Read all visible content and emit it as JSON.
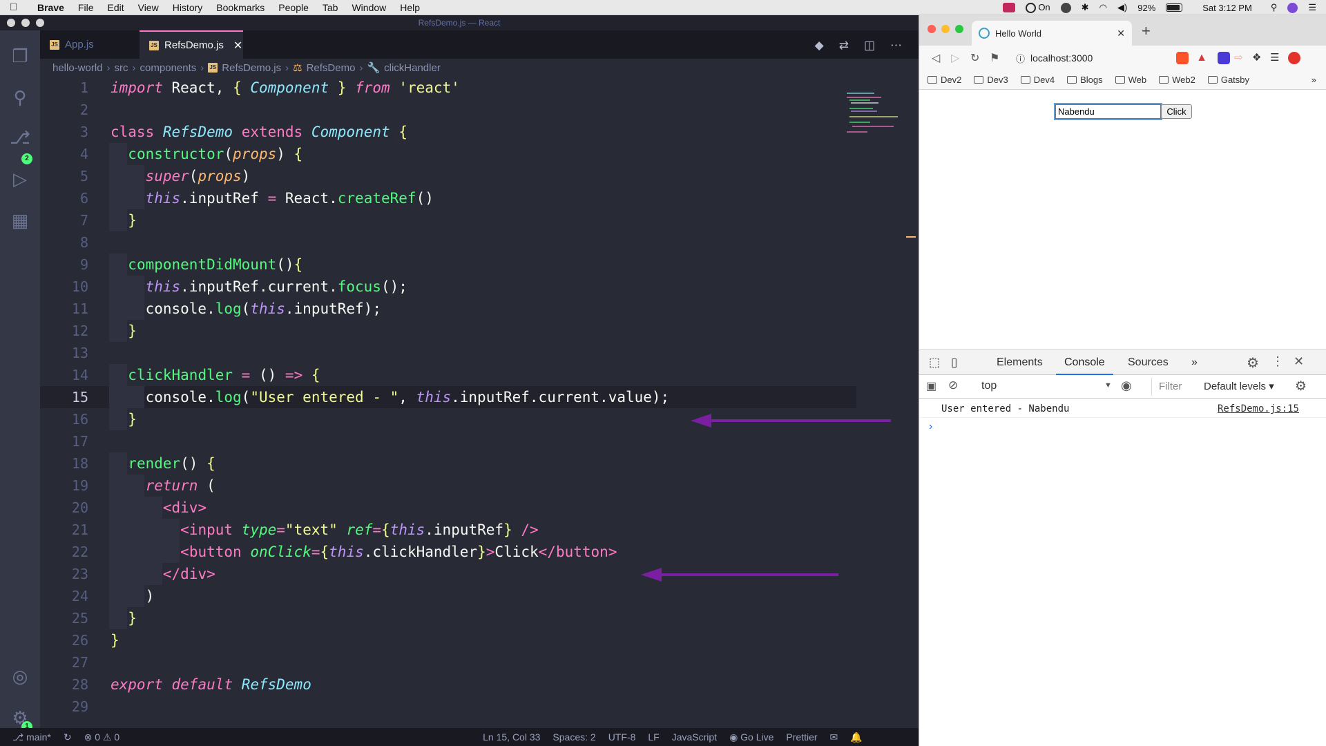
{
  "menubar": {
    "app": "Brave",
    "items": [
      "File",
      "Edit",
      "View",
      "History",
      "Bookmarks",
      "People",
      "Tab",
      "Window",
      "Help"
    ],
    "status_on": "On",
    "battery": "92%",
    "clock": "Sat 3:12 PM"
  },
  "vscode": {
    "title": "RefsDemo.js — React",
    "tabs": [
      {
        "label": "App.js"
      },
      {
        "label": "RefsDemo.js"
      }
    ],
    "breadcrumb": [
      "hello-world",
      "src",
      "components",
      "RefsDemo.js",
      "RefsDemo",
      "clickHandler"
    ],
    "badges": {
      "source_control": "2",
      "manage": "1"
    },
    "code_lines": [
      "import React, { Component } from 'react'",
      "",
      "class RefsDemo extends Component {",
      "  constructor(props) {",
      "    super(props)",
      "    this.inputRef = React.createRef()",
      "  }",
      "",
      "  componentDidMount(){",
      "    this.inputRef.current.focus();",
      "    console.log(this.inputRef);",
      "  }",
      "",
      "  clickHandler = () => {",
      "    console.log(\"User entered - \", this.inputRef.current.value);",
      "  }",
      "",
      "  render() {",
      "    return (",
      "      <div>",
      "        <input type=\"text\" ref={this.inputRef} />",
      "        <button onClick={this.clickHandler}>Click</button>",
      "      </div>",
      "    )",
      "  }",
      "}",
      "",
      "export default RefsDemo",
      ""
    ],
    "current_line": 15,
    "status": {
      "branch": "main*",
      "errors": "0",
      "warnings": "0",
      "position": "Ln 15, Col 33",
      "spaces": "Spaces: 2",
      "encoding": "UTF-8",
      "eol": "LF",
      "language": "JavaScript",
      "go_live": "Go Live",
      "formatter": "Prettier"
    },
    "colors": {
      "bg": "#282a36",
      "arrow": "#7b1fa2"
    }
  },
  "brave": {
    "tab_title": "Hello World",
    "url": "localhost:3000",
    "bookmarks": [
      "Dev2",
      "Dev3",
      "Dev4",
      "Blogs",
      "Web",
      "Web2",
      "Gatsby"
    ],
    "page": {
      "input_value": "Nabendu",
      "button_label": "Click"
    },
    "devtools": {
      "tabs": [
        "Elements",
        "Console",
        "Sources"
      ],
      "active_tab": "Console",
      "context": "top",
      "filter_placeholder": "Filter",
      "levels": "Default levels",
      "console_message": "User entered -  Nabendu",
      "console_source": "RefsDemo.js:15"
    }
  }
}
